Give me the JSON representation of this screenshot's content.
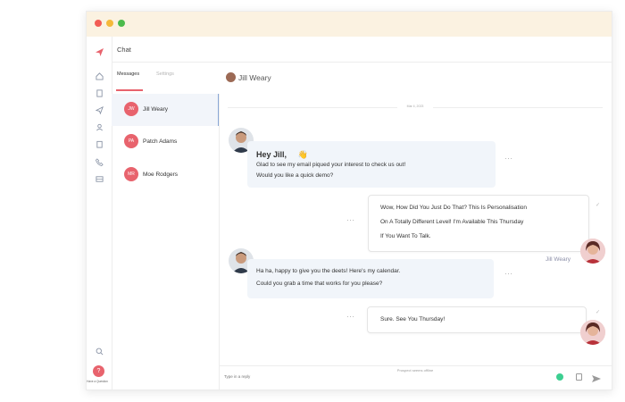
{
  "app": {
    "header_title": "Chat"
  },
  "tabs": [
    {
      "label": "Messages",
      "active": true
    },
    {
      "label": "Settings",
      "active": false
    }
  ],
  "contacts": [
    {
      "initials": "JW",
      "name": "Jill Weary",
      "active": true
    },
    {
      "initials": "PA",
      "name": "Patch Adams",
      "active": false
    },
    {
      "initials": "MR",
      "name": "Moe Rodgers",
      "active": false
    }
  ],
  "chat": {
    "contact_name": "Jill Weary",
    "date": "Mar 4, 2023",
    "messages": [
      {
        "from": "agent",
        "greeting": "Hey Jill,",
        "emoji": "👋",
        "lines": [
          "Glad to see my email piqued your interest to check us out!",
          "Would you like a quick demo?"
        ]
      },
      {
        "from": "contact",
        "sender": "Jill Weary",
        "lines": [
          "Wow, How Did You Just Do That? This Is Personalisation",
          "On A Totally Different Level! I'm Available This Thursday",
          "If You Want To Talk."
        ]
      },
      {
        "from": "agent",
        "lines": [
          "Ha ha, happy to give you the deets! Here's my calendar.",
          "Could you grab a time that works for you please?"
        ]
      },
      {
        "from": "contact",
        "lines": [
          "Sure. See You Thursday!"
        ]
      }
    ],
    "status": "Prospect seems offline",
    "composer_placeholder": "Type in a reply"
  },
  "sidebar": {
    "ask_label": "Have a Question"
  },
  "colors": {
    "accent": "#e8636d",
    "titlebar": "#fbf2e1",
    "bubble_in": "#f1f5fa",
    "online": "#3ccf91",
    "mac_close": "#f25c54",
    "mac_min": "#f5b93a",
    "mac_max": "#4cbb4c"
  }
}
